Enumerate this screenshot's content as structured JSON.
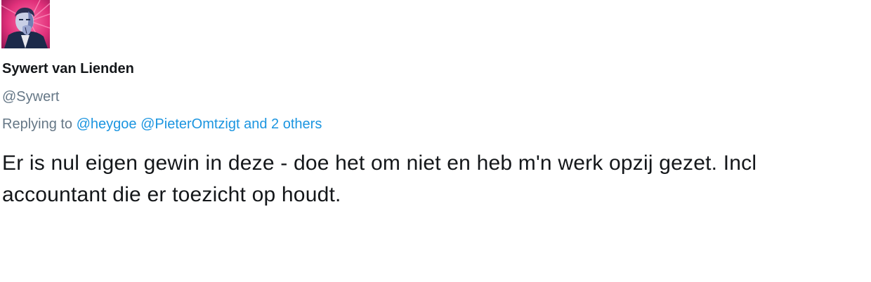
{
  "tweet": {
    "author": {
      "display_name": "Sywert van Lienden",
      "handle": "@Sywert"
    },
    "reply": {
      "prefix": "Replying to",
      "mentions": [
        "@heygoe",
        "@PieterOmtzigt"
      ],
      "others": "and 2 others"
    },
    "text": "Er is nul eigen gewin in deze - doe het om niet en heb m'n werk opzij gezet. Incl accountant die er toezicht op houdt."
  },
  "colors": {
    "text": "#14171a",
    "secondary": "#657786",
    "link": "#1b95e0"
  }
}
